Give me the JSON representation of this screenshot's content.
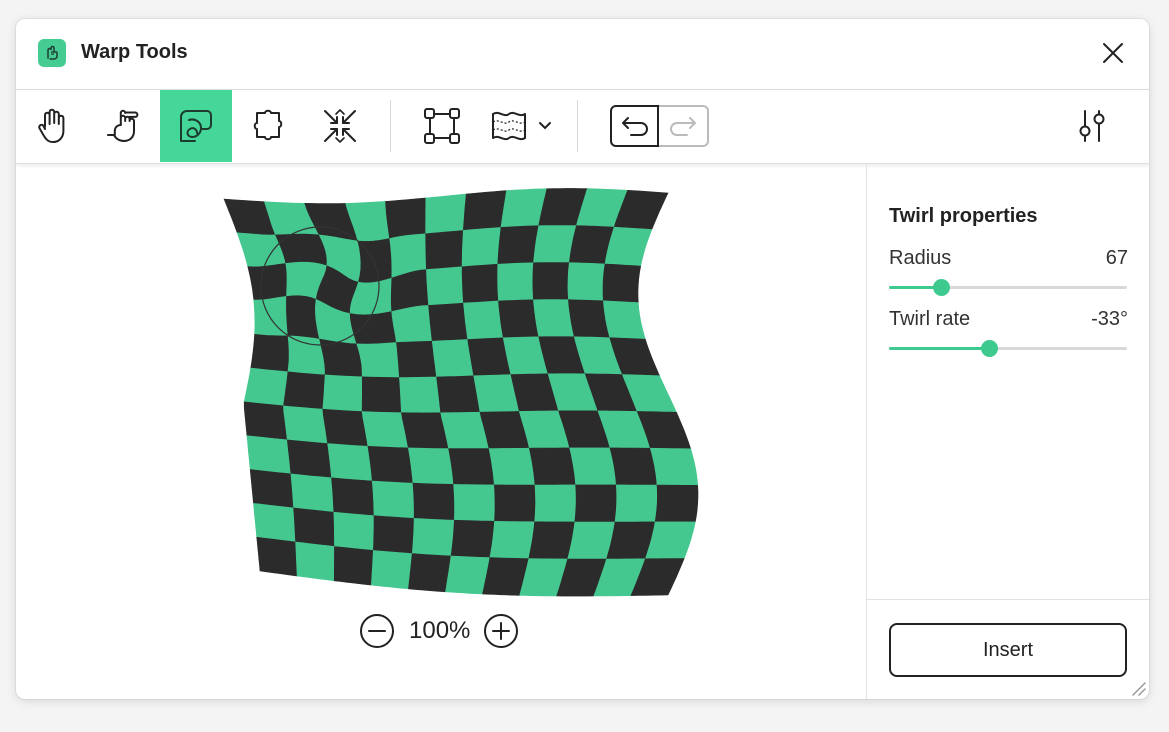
{
  "window": {
    "title": "Warp Tools"
  },
  "colors": {
    "accent": "#45d79a",
    "dark": "#2b2b2b",
    "green": "#45c890"
  },
  "toolbar": {
    "tools": [
      {
        "name": "hand-tool",
        "icon": "hand-icon",
        "active": false
      },
      {
        "name": "finger-tool",
        "icon": "pointing-hand-icon",
        "active": false
      },
      {
        "name": "twirl-tool",
        "icon": "twirl-icon",
        "active": true
      },
      {
        "name": "bloat-tool",
        "icon": "puzzle-shape-icon",
        "active": false
      },
      {
        "name": "pucker-tool",
        "icon": "pucker-arrows-icon",
        "active": false
      },
      {
        "name": "envelope-tool",
        "icon": "bounding-box-icon",
        "active": false
      },
      {
        "name": "wave-tool",
        "icon": "wave-flag-icon",
        "active": false,
        "dropdown": true
      }
    ],
    "undo": {
      "icon": "undo-icon"
    },
    "redo": {
      "icon": "redo-icon",
      "enabled": false
    },
    "settings": {
      "icon": "sliders-icon"
    }
  },
  "canvas": {
    "zoom_label": "100%"
  },
  "properties": {
    "title": "Twirl properties",
    "radius": {
      "label": "Radius",
      "value": "67",
      "fraction": 0.22
    },
    "twirl_rate": {
      "label": "Twirl rate",
      "value": "-33°",
      "fraction": 0.42
    }
  },
  "footer": {
    "insert_label": "Insert"
  }
}
